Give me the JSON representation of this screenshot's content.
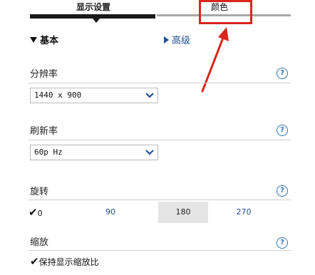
{
  "tabs": [
    {
      "label": "显示设置",
      "active": true
    },
    {
      "label": "颜色",
      "active": false
    }
  ],
  "view_toggle": {
    "basic": "基本",
    "advanced": "高级"
  },
  "sections": {
    "resolution": {
      "title": "分辨率",
      "value": "1440 x 900"
    },
    "refresh_rate": {
      "title": "刷新率",
      "value": "60p Hz"
    },
    "rotation": {
      "title": "旋转",
      "options": [
        "0",
        "90",
        "180",
        "270"
      ],
      "checked": "0"
    },
    "scale": {
      "title": "缩放",
      "option": "保持显示缩放比",
      "checked": true
    }
  },
  "help_symbol": "?",
  "colors": {
    "accent": "#1f4f96",
    "annotation": "#d9261c",
    "help": "#2f73b8"
  }
}
